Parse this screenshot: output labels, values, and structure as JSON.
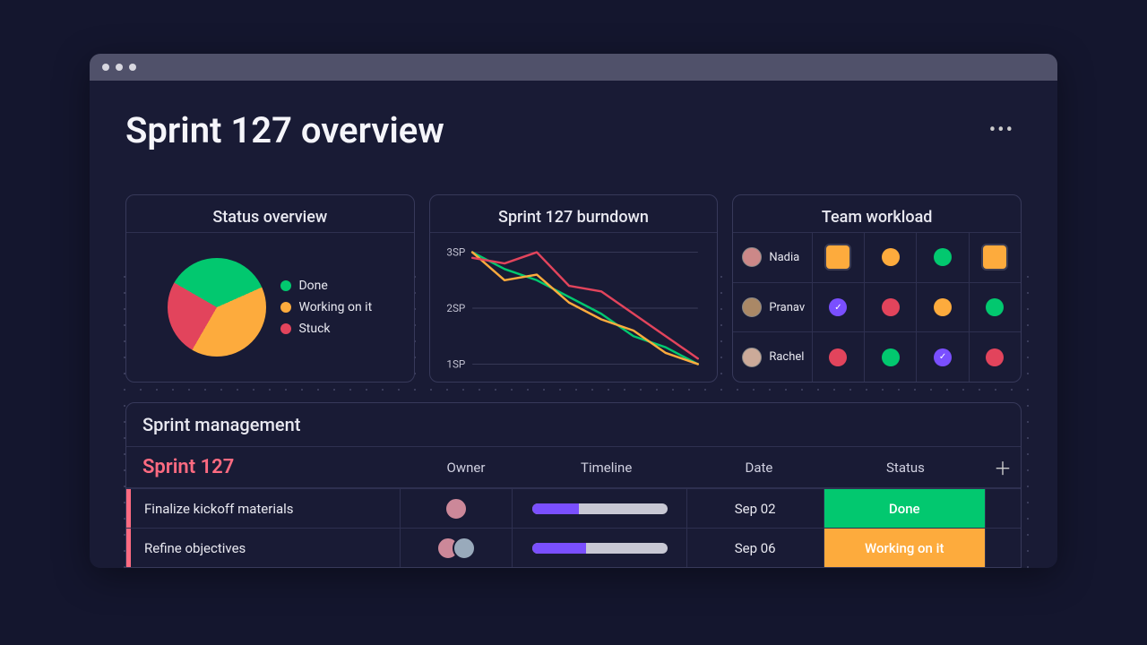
{
  "page": {
    "title": "Sprint 127 overview"
  },
  "colors": {
    "done": "#02c86f",
    "working": "#fdab3d",
    "stuck": "#e2445c",
    "purple": "#7a4fff",
    "accent": "#ff6b81"
  },
  "cards": {
    "status": {
      "title": "Status overview",
      "legend": [
        {
          "label": "Done",
          "color": "#02c86f"
        },
        {
          "label": "Working on it",
          "color": "#fdab3d"
        },
        {
          "label": "Stuck",
          "color": "#e2445c"
        }
      ]
    },
    "burndown": {
      "title": "Sprint 127 burndown",
      "y_ticks": [
        "3SP",
        "2SP",
        "1SP"
      ]
    },
    "workload": {
      "title": "Team workload",
      "members": [
        {
          "name": "Nadia",
          "cells": [
            {
              "color": "#fdab3d",
              "highlight": true
            },
            {
              "color": "#fdab3d"
            },
            {
              "color": "#02c86f"
            },
            {
              "color": "#fdab3d",
              "highlight": true
            }
          ]
        },
        {
          "name": "Pranav",
          "cells": [
            {
              "color": "#7a4fff",
              "check": true
            },
            {
              "color": "#e2445c"
            },
            {
              "color": "#fdab3d"
            },
            {
              "color": "#02c86f"
            }
          ]
        },
        {
          "name": "Rachel",
          "cells": [
            {
              "color": "#e2445c"
            },
            {
              "color": "#02c86f"
            },
            {
              "color": "#7a4fff",
              "check": true
            },
            {
              "color": "#e2445c"
            }
          ]
        }
      ]
    }
  },
  "sprint_mgmt": {
    "title": "Sprint management",
    "sprint_label": "Sprint 127",
    "columns": [
      "Owner",
      "Timeline",
      "Date",
      "Status"
    ],
    "rows": [
      {
        "task": "Finalize kickoff materials",
        "owners": 1,
        "progress": 0.35,
        "progress_color": "#7a4fff",
        "date": "Sep 02",
        "status": "Done",
        "status_color": "#02c86f"
      },
      {
        "task": "Refine objectives",
        "owners": 2,
        "progress": 0.4,
        "progress_color": "#7a4fff",
        "date": "Sep 06",
        "status": "Working on it",
        "status_color": "#fdab3d"
      }
    ]
  },
  "chart_data": [
    {
      "type": "pie",
      "title": "Status overview",
      "series": [
        {
          "name": "Done",
          "value": 35,
          "color": "#02c86f"
        },
        {
          "name": "Working on it",
          "value": 40,
          "color": "#fdab3d"
        },
        {
          "name": "Stuck",
          "value": 25,
          "color": "#e2445c"
        }
      ]
    },
    {
      "type": "line",
      "title": "Sprint 127 burndown",
      "ylabel": "SP",
      "ylim": [
        1,
        3
      ],
      "x": [
        0,
        1,
        2,
        3,
        4,
        5,
        6,
        7
      ],
      "series": [
        {
          "name": "Done",
          "color": "#02c86f",
          "values": [
            3.0,
            2.7,
            2.5,
            2.2,
            1.9,
            1.5,
            1.3,
            1.0
          ]
        },
        {
          "name": "Working on it",
          "color": "#fdab3d",
          "values": [
            3.0,
            2.5,
            2.6,
            2.1,
            1.8,
            1.6,
            1.2,
            1.0
          ]
        },
        {
          "name": "Stuck",
          "color": "#e2445c",
          "values": [
            2.9,
            2.8,
            3.0,
            2.4,
            2.3,
            1.9,
            1.5,
            1.1
          ]
        }
      ]
    }
  ]
}
